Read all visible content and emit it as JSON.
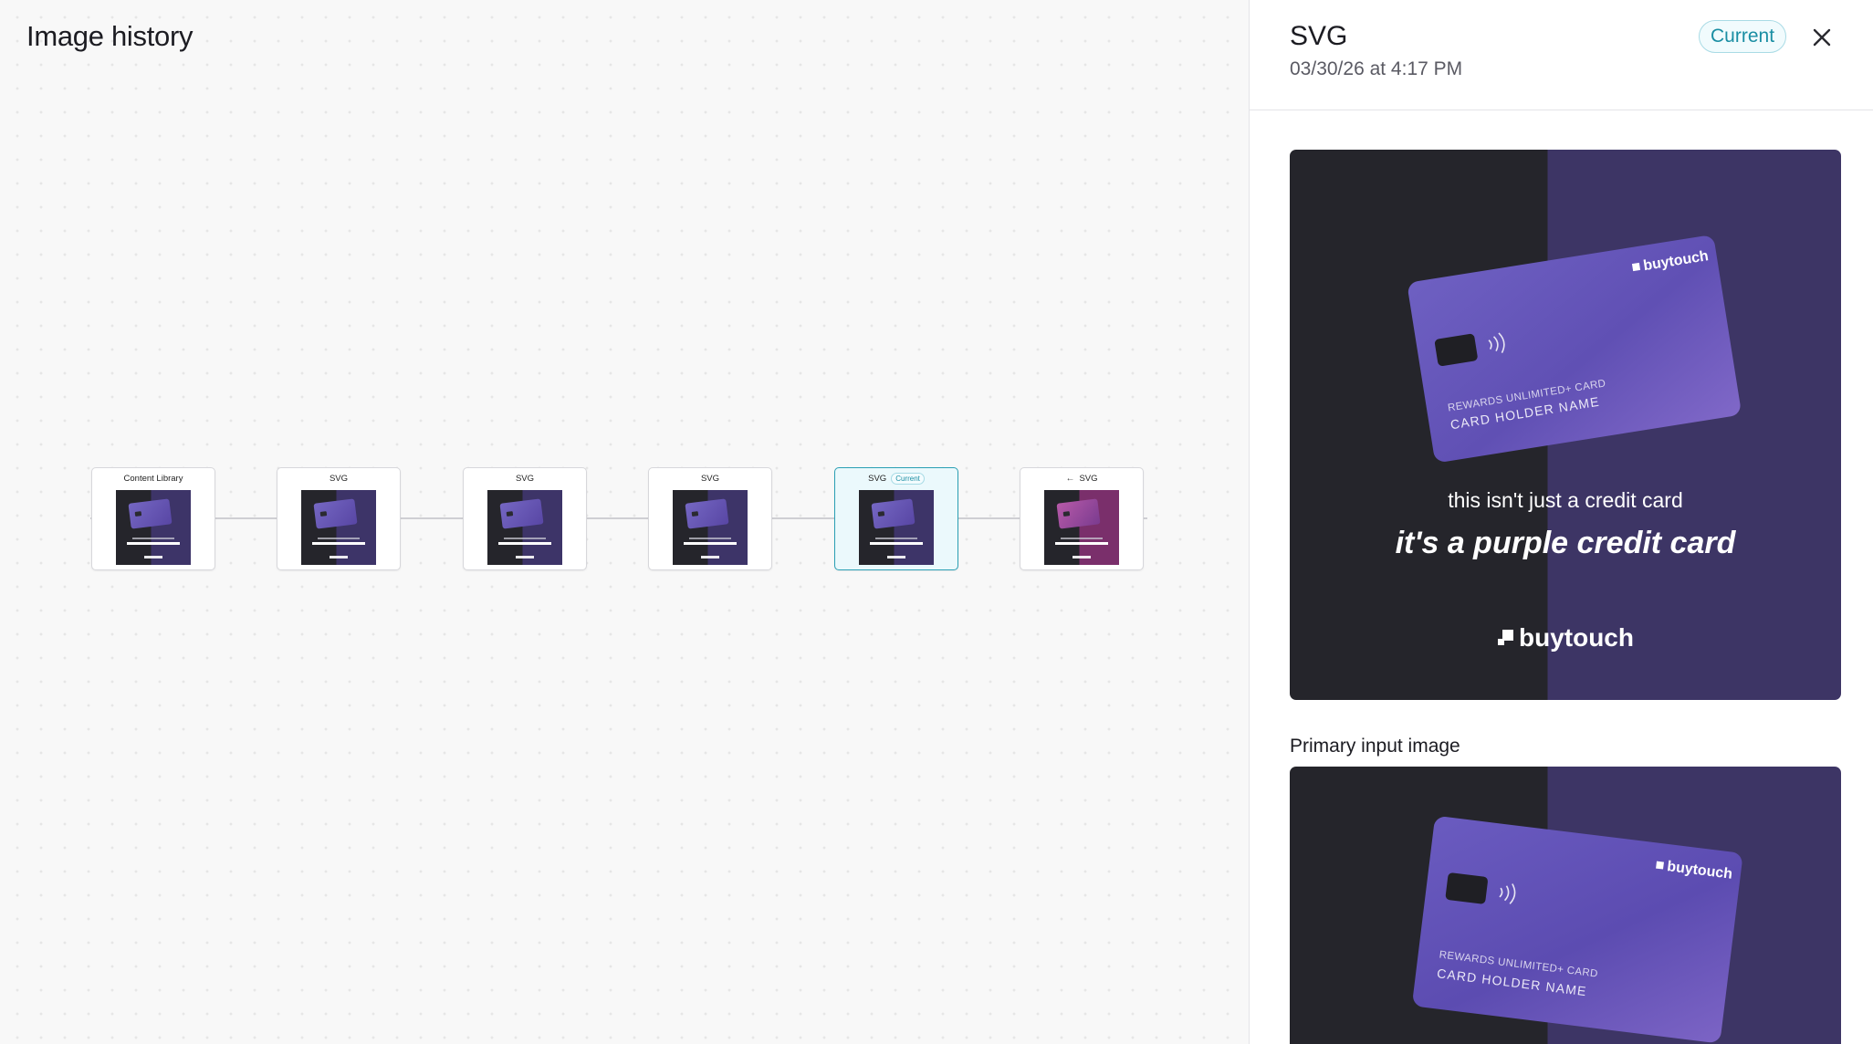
{
  "canvas": {
    "title": "Image history",
    "nodes": [
      {
        "label": "Content Library",
        "badge": "",
        "prefix": "",
        "variant": "purple"
      },
      {
        "label": "SVG",
        "badge": "",
        "prefix": "",
        "variant": "purple"
      },
      {
        "label": "SVG",
        "badge": "",
        "prefix": "",
        "variant": "purple"
      },
      {
        "label": "SVG",
        "badge": "",
        "prefix": "",
        "variant": "purple"
      },
      {
        "label": "SVG",
        "badge": "Current",
        "prefix": "",
        "variant": "purple"
      },
      {
        "label": "SVG",
        "badge": "",
        "prefix": "←",
        "variant": "pink"
      }
    ]
  },
  "panel": {
    "title": "SVG",
    "date": "03/30/26 at 4:17 PM",
    "badge": "Current",
    "close_icon": "close-icon",
    "preview": {
      "brand_on_card": "buytouch",
      "card_line1": "REWARDS UNLIMITED+ CARD",
      "card_line2": "CARD HOLDER NAME",
      "tagline": "this isn't just a credit card",
      "headline": "it's a purple credit card",
      "brand": "buytouch"
    },
    "input_section": {
      "label": "Primary input image",
      "brand_on_card": "buytouch",
      "card_line1": "REWARDS UNLIMITED+ CARD",
      "card_line2": "CARD HOLDER NAME"
    }
  },
  "colors": {
    "accent": "#1a8ea3",
    "dark_bg": "#25252b",
    "purple_bg": "#3d3565",
    "card_purple": "#6a5bbf"
  }
}
